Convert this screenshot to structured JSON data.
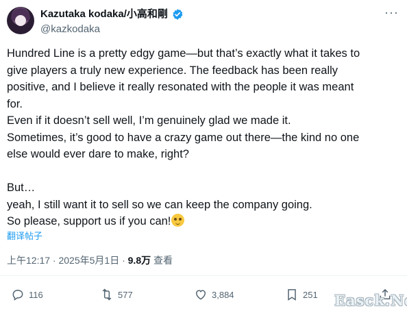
{
  "author": {
    "name": "Kazutaka kodaka/小高和剛",
    "handle": "@kazkodaka",
    "verified_color": "#1d9bf0"
  },
  "tweet": {
    "lines": [
      "Hundred Line is a pretty edgy game—but that’s exactly what it takes to",
      "give players a truly new experience. The feedback has been really",
      "positive, and I believe it really resonated with the people it was meant",
      "for.",
      "Even if it doesn’t sell well, I’m genuinely glad we made it.",
      "Sometimes, it’s good to have a crazy game out there—the kind no one",
      "else would ever dare to make, right?",
      "But…",
      "yeah, I still want it to sell so we can keep the company going.",
      "So please, support us if you can!"
    ],
    "translate_label": "翻译帖子",
    "timestamp": "上午12:17 · 2025年5月1日 · ",
    "views_count": "9.8万",
    "views_label": " 查看"
  },
  "actions": {
    "replies": "116",
    "reposts": "577",
    "likes": "3,884",
    "bookmarks": "251"
  },
  "watermark": "Easck.Net",
  "icons": [
    "more-icon",
    "verified-icon",
    "reply-icon",
    "repost-icon",
    "like-icon",
    "bookmark-icon",
    "share-icon",
    "smiling-emoji-icon"
  ]
}
